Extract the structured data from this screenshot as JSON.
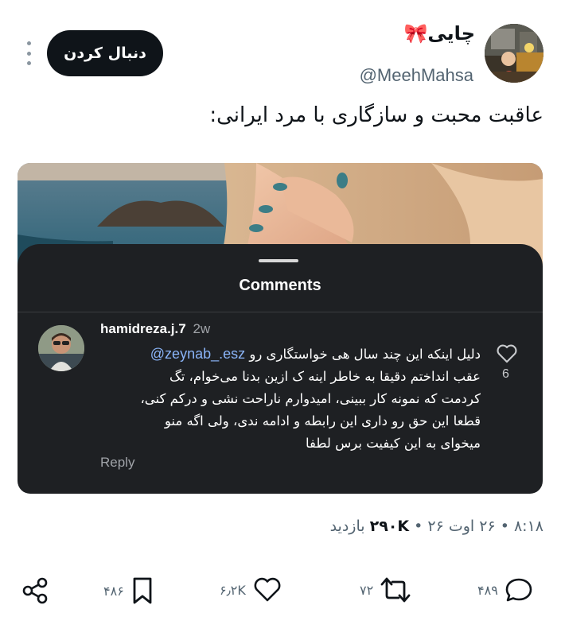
{
  "tweet": {
    "display_name": "چایی",
    "display_emoji": "🎀",
    "handle": "@MeehMahsa",
    "follow_label": "دنبال کردن",
    "text": "عاقبت محبت و سازگاری با مرد ایرانی:",
    "meta": {
      "time": "۸:۱۸",
      "date": "۲۶ اوت ۲۶",
      "views": "۲۹۰K",
      "views_label": "بازدید"
    }
  },
  "comment_sheet": {
    "title": "Comments",
    "comment": {
      "username": "hamidreza.j.7",
      "time": "2w",
      "mention": "@zeynab_.esz",
      "line1": "دلیل اینکه این چند سال هی خواستگاری رو",
      "line2": "عقب انداختم دقیقا به خاطر اینه ک ازین بدنا می‌خوام، تگ",
      "line3": "کردمت که نمونه کار ببینی، امیدوارم ناراحت نشی و درکم کنی،",
      "line4": "قطعا این حق رو داری این رابطه و ادامه ندی، ولی اگه منو",
      "line5": "میخوای به این کیفیت برس لطفا",
      "reply_label": "Reply",
      "likes": "6"
    }
  },
  "actions": {
    "reply_count": "۴۸۹",
    "repost_count": "۷۲",
    "like_count": "۶٫۲K",
    "bookmark_count": "۴۸۶"
  },
  "icons": {
    "more": "more-vertical-icon",
    "reply": "reply-icon",
    "repost": "repost-icon",
    "like": "heart-icon",
    "bookmark": "bookmark-icon",
    "share": "share-icon"
  },
  "colors": {
    "text": "#0f1419",
    "secondary": "#536471",
    "sheet_bg": "#1e2023",
    "mention": "#8ab4f8"
  }
}
